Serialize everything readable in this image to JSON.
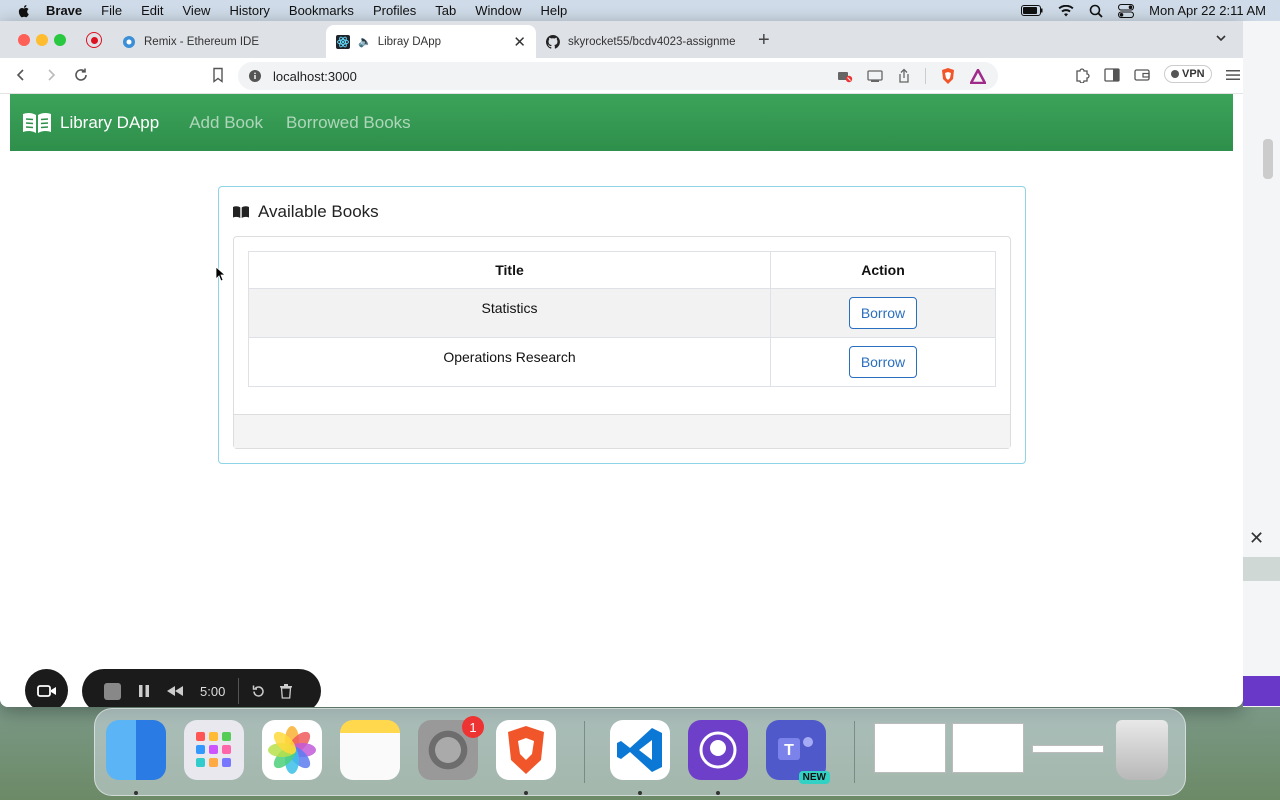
{
  "menubar": {
    "app": "Brave",
    "items": [
      "File",
      "Edit",
      "View",
      "History",
      "Bookmarks",
      "Profiles",
      "Tab",
      "Window",
      "Help"
    ],
    "clock": "Mon Apr 22  2:11 AM"
  },
  "tabs": [
    {
      "label": "Remix - Ethereum IDE",
      "icon": "remix-icon"
    },
    {
      "label": "Libray DApp",
      "icon": "react-icon"
    },
    {
      "label": "skyrocket55/bcdv4023-assignme",
      "icon": "github-icon"
    }
  ],
  "toolbar": {
    "url": "localhost:3000",
    "vpn_label": "VPN"
  },
  "navbar": {
    "brand": "Library DApp",
    "links": [
      "Add Book",
      "Borrowed Books"
    ]
  },
  "card": {
    "title": "Available Books",
    "table": {
      "headers": [
        "Title",
        "Action"
      ],
      "rows": [
        {
          "title": "Statistics",
          "action": "Borrow"
        },
        {
          "title": "Operations Research",
          "action": "Borrow"
        }
      ]
    }
  },
  "recorder": {
    "timer": "5:00"
  },
  "dock": {
    "settings_badge": "1",
    "teams_badge": "NEW"
  },
  "colors": {
    "navbar_green": "#34a055",
    "card_border": "#8fd3e6",
    "button_blue": "#2a6fbf"
  }
}
